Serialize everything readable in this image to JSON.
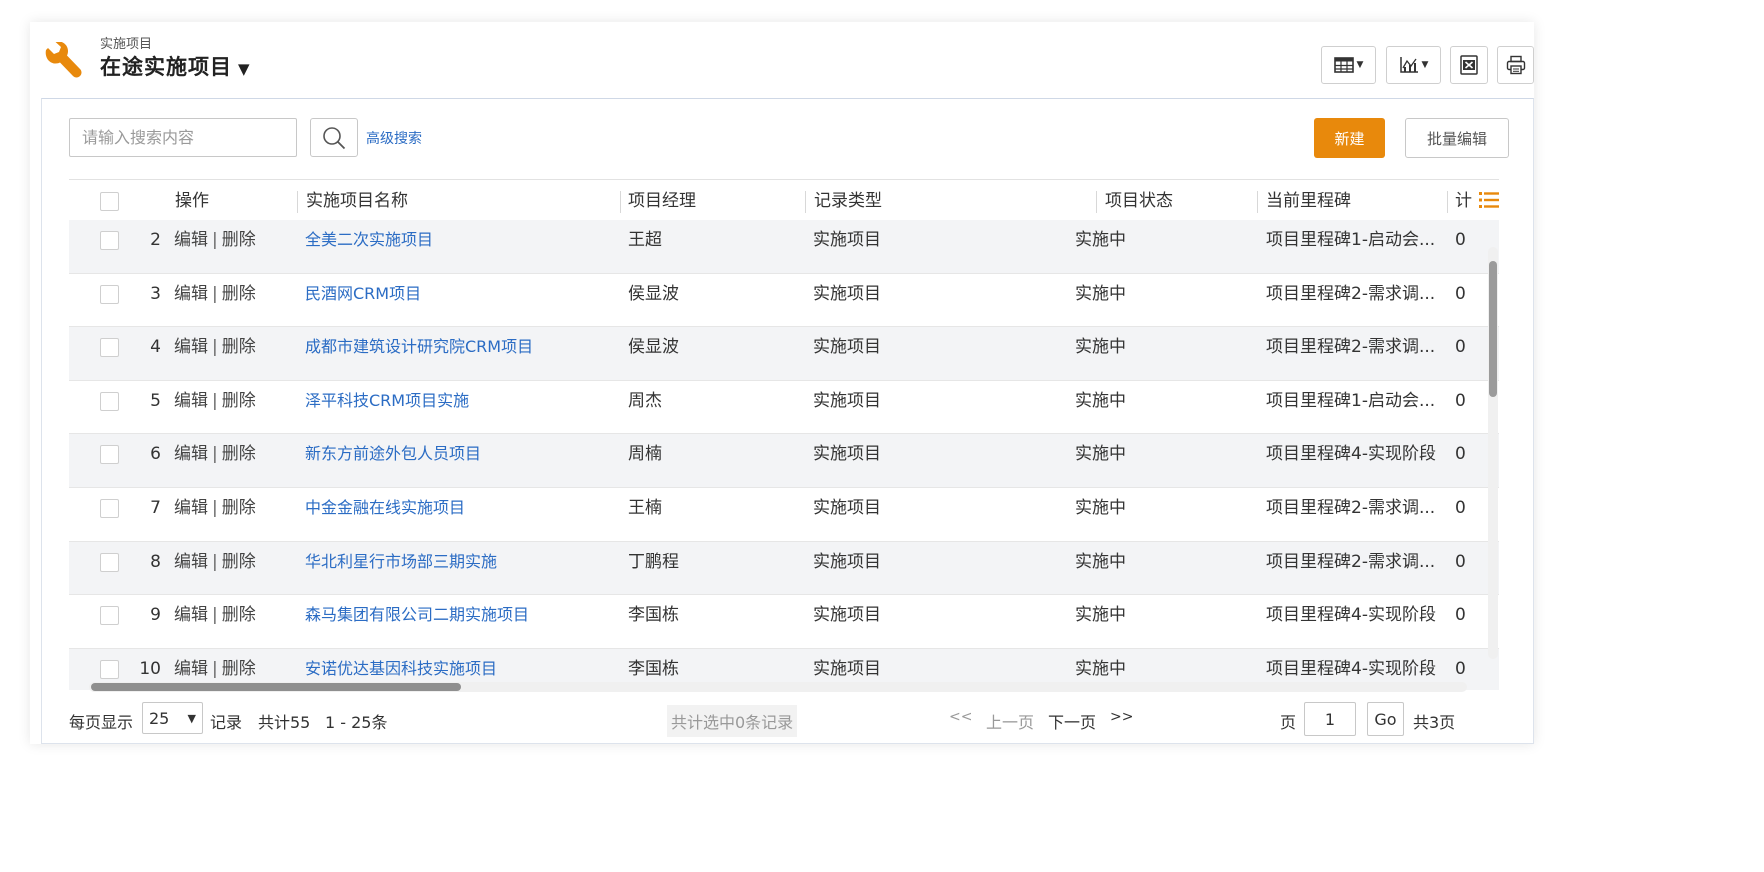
{
  "header": {
    "breadcrumb": "实施项目",
    "title": "在途实施项目",
    "title_caret": "▼"
  },
  "toolbar": {
    "icons": [
      "table-view-icon",
      "chart-icon",
      "excel-export-icon",
      "print-icon"
    ],
    "accent": "#e8890c"
  },
  "search": {
    "placeholder": "请输入搜索内容",
    "advanced_label": "高级搜索"
  },
  "actions": {
    "new_label": "新建",
    "batch_edit_label": "批量编辑"
  },
  "table": {
    "columns": [
      "操作",
      "实施项目名称",
      "项目经理",
      "记录类型",
      "项目状态",
      "当前里程碑",
      "计"
    ],
    "edit_label": "编辑",
    "separator": "|",
    "delete_label": "删除",
    "rows": [
      {
        "no": "2",
        "name": "全美二次实施项目",
        "manager": "王超",
        "type": "实施项目",
        "status": "实施中",
        "milestone": "项目里程碑1-启动会...",
        "count": "0"
      },
      {
        "no": "3",
        "name": "民酒网CRM项目",
        "manager": "侯显波",
        "type": "实施项目",
        "status": "实施中",
        "milestone": "项目里程碑2-需求调...",
        "count": "0"
      },
      {
        "no": "4",
        "name": "成都市建筑设计研究院CRM项目",
        "manager": "侯显波",
        "type": "实施项目",
        "status": "实施中",
        "milestone": "项目里程碑2-需求调...",
        "count": "0"
      },
      {
        "no": "5",
        "name": "泽平科技CRM项目实施",
        "manager": "周杰",
        "type": "实施项目",
        "status": "实施中",
        "milestone": "项目里程碑1-启动会...",
        "count": "0"
      },
      {
        "no": "6",
        "name": "新东方前途外包人员项目",
        "manager": "周楠",
        "type": "实施项目",
        "status": "实施中",
        "milestone": "项目里程碑4-实现阶段",
        "count": "0"
      },
      {
        "no": "7",
        "name": "中金金融在线实施项目",
        "manager": "王楠",
        "type": "实施项目",
        "status": "实施中",
        "milestone": "项目里程碑2-需求调...",
        "count": "0"
      },
      {
        "no": "8",
        "name": "华北利星行市场部三期实施",
        "manager": "丁鹏程",
        "type": "实施项目",
        "status": "实施中",
        "milestone": "项目里程碑2-需求调...",
        "count": "0"
      },
      {
        "no": "9",
        "name": "森马集团有限公司二期实施项目",
        "manager": "李国栋",
        "type": "实施项目",
        "status": "实施中",
        "milestone": "项目里程碑4-实现阶段",
        "count": "0"
      },
      {
        "no": "10",
        "name": "安诺优达基因科技实施项目",
        "manager": "李国栋",
        "type": "实施项目",
        "status": "实施中",
        "milestone": "项目里程碑4-实现阶段",
        "count": "0"
      }
    ]
  },
  "footer": {
    "per_page_label": "每页显示",
    "page_size": "25",
    "records_label": "记录",
    "total_label": "共计55",
    "range_label": "1 - 25条",
    "selected_label": "共计选中0条记录",
    "first_label": "<<",
    "prev_label": "上一页",
    "next_label": "下一页",
    "last_label": ">>",
    "page_label": "页",
    "current_page": "1",
    "go_label": "Go",
    "total_pages_label": "共3页"
  }
}
